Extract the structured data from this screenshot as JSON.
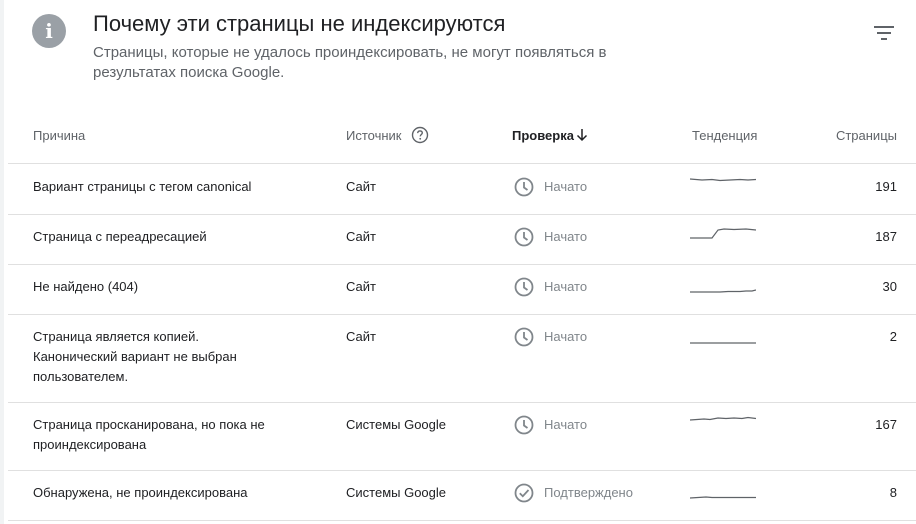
{
  "header": {
    "info_icon_glyph": "i",
    "title": "Почему эти страницы не индексируются",
    "subtitle": "Страницы, которые не удалось проиндексировать, не могут появляться в результатах поиска Google."
  },
  "table": {
    "columns": {
      "reason": "Причина",
      "source": "Источник",
      "validation": "Проверка",
      "trend": "Тенденция",
      "pages": "Страницы"
    },
    "rows": [
      {
        "reason": "Вариант страницы с тегом canonical",
        "source": "Сайт",
        "status": "Начато",
        "status_icon": "clock-icon",
        "pages": "191"
      },
      {
        "reason": "Страница с переадресацией",
        "source": "Сайт",
        "status": "Начато",
        "status_icon": "clock-icon",
        "pages": "187"
      },
      {
        "reason": "Не найдено (404)",
        "source": "Сайт",
        "status": "Начато",
        "status_icon": "clock-icon",
        "pages": "30"
      },
      {
        "reason": "Страница является копией. Канонический вариант не выбран пользователем.",
        "source": "Сайт",
        "status": "Начато",
        "status_icon": "clock-icon",
        "pages": "2"
      },
      {
        "reason": "Страница просканирована, но пока не проиндексирована",
        "source": "Системы Google",
        "status": "Начато",
        "status_icon": "clock-icon",
        "pages": "167"
      },
      {
        "reason": "Обнаружена, не проиндексирована",
        "source": "Системы Google",
        "status": "Подтверждено",
        "status_icon": "check-circle-icon",
        "pages": "8"
      }
    ]
  },
  "colors": {
    "icon_grey": "#80868b",
    "text_grey": "#5f6368",
    "divider": "#e0e0e0"
  }
}
